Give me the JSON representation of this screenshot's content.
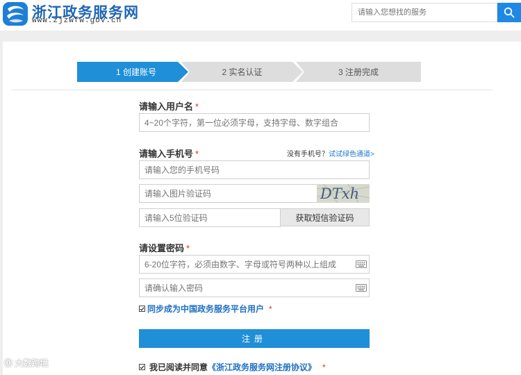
{
  "header": {
    "site_title": "浙江政务服务网",
    "site_url": "www.zjzwfw.gov.cn",
    "search_placeholder": "请输入您想找的服务"
  },
  "steps": [
    {
      "label": "1 创建账号",
      "active": true
    },
    {
      "label": "2 实名认证",
      "active": false
    },
    {
      "label": "3 注册完成",
      "active": false
    }
  ],
  "form": {
    "username": {
      "label": "请输入用户名",
      "required_mark": "*",
      "placeholder": "4~20个字符，第一位必须字母，支持字母、数字组合"
    },
    "phone": {
      "label": "请输入手机号",
      "required_mark": "*",
      "no_phone_text": "没有手机号？",
      "green_channel_link": "试试绿色通道>",
      "placeholder": "请输入您的手机号码"
    },
    "image_captcha": {
      "placeholder": "请输入图片验证码",
      "captcha_text": "DTxh"
    },
    "sms_code": {
      "placeholder": "请输入5位验证码",
      "button_label": "获取短信验证码"
    },
    "password": {
      "label": "请设置密码",
      "required_mark": "*",
      "placeholder": "6-20位字符，必须由数字、字母或符号两种以上组成",
      "confirm_placeholder": "请确认输入密码"
    },
    "sync_checkbox": {
      "label": "同步成为中国政务服务平台用户",
      "required_mark": "*",
      "checked": true
    },
    "register_button": "注册",
    "agreement": {
      "prefix": "我已阅读并同意",
      "link": "《浙江政务服务网注册协议》",
      "required_mark": "*",
      "checked": true
    }
  },
  "watermark": "大数跨境",
  "colors": {
    "primary": "#1f8fd7",
    "link": "#1e6fc4",
    "required": "#e02a2a",
    "step_inactive": "#dddddd",
    "page_bg": "#eeeeee"
  }
}
